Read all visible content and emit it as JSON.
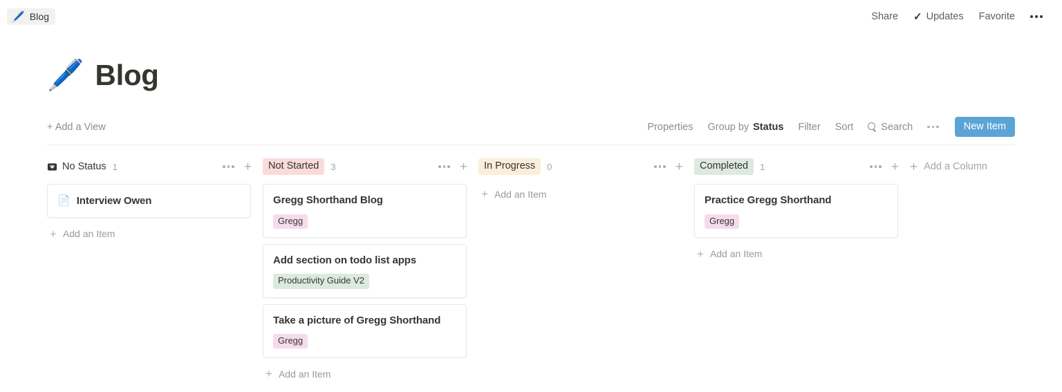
{
  "topbar": {
    "breadcrumb": {
      "icon": "pen-icon",
      "glyph": "🖊️",
      "label": "Blog"
    },
    "share_label": "Share",
    "updates_label": "Updates",
    "updates_check": "✓",
    "favorite_label": "Favorite",
    "more_menu": "more-options-icon"
  },
  "page": {
    "emoji": "🖊️",
    "title": "Blog"
  },
  "viewbar": {
    "add_view_label": "+ Add a View",
    "properties_label": "Properties",
    "group_by_prefix": "Group by",
    "group_by_value": "Status",
    "filter_label": "Filter",
    "sort_label": "Sort",
    "search_label": "Search",
    "more_label": "more-options-icon",
    "new_item_label": "New Item"
  },
  "board": {
    "add_column_label": "Add a Column",
    "add_item_label": "Add an Item",
    "columns": [
      {
        "name": "No Status",
        "count": "1",
        "pill": false,
        "pill_bg": "transparent",
        "has_tray_icon": true,
        "cards": [
          {
            "title": "Interview Owen",
            "icon": "document-icon",
            "glyph": "📄",
            "tag": null,
            "tag_bg": null
          }
        ]
      },
      {
        "name": "Not Started",
        "count": "3",
        "pill": true,
        "pill_bg": "#fadbdb",
        "has_tray_icon": false,
        "cards": [
          {
            "title": "Gregg Shorthand Blog",
            "icon": null,
            "glyph": "",
            "tag": "Gregg",
            "tag_bg": "#f5dced"
          },
          {
            "title": "Add section on todo list apps",
            "icon": null,
            "glyph": "",
            "tag": "Productivity Guide V2",
            "tag_bg": "#dceade"
          },
          {
            "title": "Take a picture of Gregg Shorthand",
            "icon": null,
            "glyph": "",
            "tag": "Gregg",
            "tag_bg": "#f5dced"
          }
        ]
      },
      {
        "name": "In Progress",
        "count": "0",
        "pill": true,
        "pill_bg": "#faeedd",
        "has_tray_icon": false,
        "cards": []
      },
      {
        "name": "Completed",
        "count": "1",
        "pill": true,
        "pill_bg": "#dde9e1",
        "has_tray_icon": false,
        "cards": [
          {
            "title": "Practice Gregg Shorthand",
            "icon": null,
            "glyph": "",
            "tag": "Gregg",
            "tag_bg": "#f5dced"
          }
        ]
      }
    ]
  }
}
